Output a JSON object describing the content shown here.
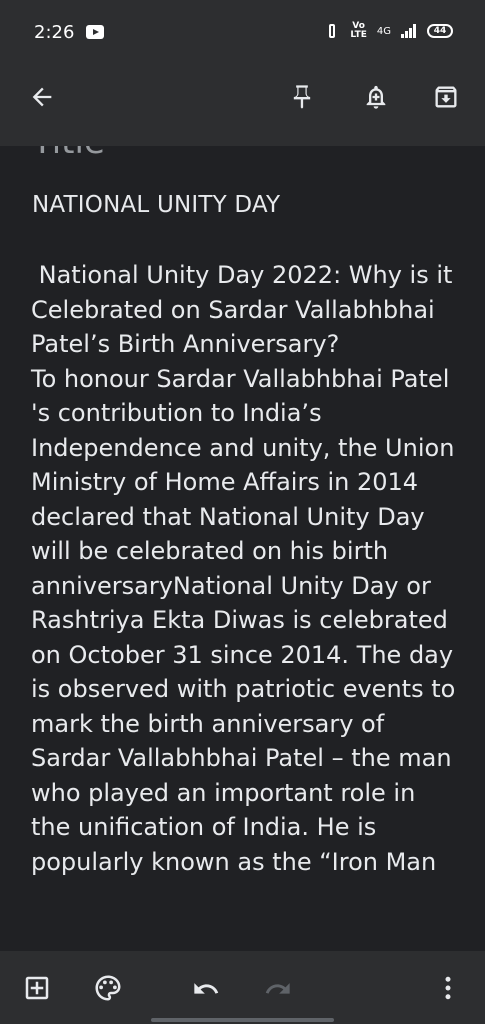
{
  "status_bar": {
    "time": "2:26",
    "volte_top": "Vo",
    "volte_bottom": "LTE",
    "network": "4G",
    "battery": "44"
  },
  "app_bar": {
    "back_icon": "arrow-back-icon",
    "pin_icon": "pin-icon",
    "reminder_icon": "add-alert-icon",
    "archive_icon": "archive-icon"
  },
  "note": {
    "title_placeholder": "Title",
    "title": "NATIONAL UNITY DAY",
    "body": " National Unity Day 2022: Why is it Celebrated on Sardar Vallabhbhai Patel’s Birth Anniversary?\nTo honour Sardar Vallabhbhai Patel 's contribution to India’s Independence and unity, the Union Ministry of Home Affairs in 2014 declared that National Unity Day will be celebrated on his birth anniversaryNational Unity Day or Rashtriya Ekta Diwas is celebrated on October 31 since 2014. The day is observed with patriotic events to mark the birth anniversary of Sardar Vallabhbhai Patel – the man who played an important role in the unification of India. He is popularly known as the “Iron Man"
  },
  "bottom_bar": {
    "add_icon": "add-box-icon",
    "palette_icon": "palette-icon",
    "undo_icon": "undo-icon",
    "redo_icon": "redo-icon",
    "more_icon": "more-vert-icon"
  }
}
